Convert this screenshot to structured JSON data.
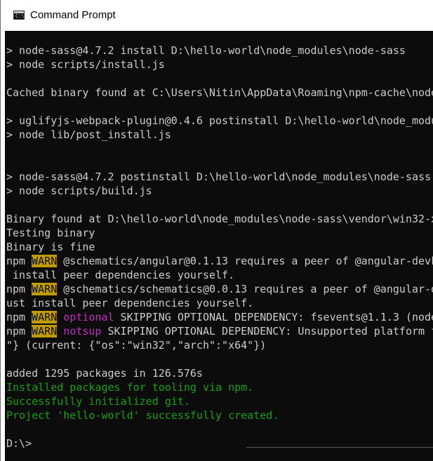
{
  "window": {
    "title": "Command Prompt",
    "icon": "cmd-icon",
    "icon_glyph": "C:\\",
    "colors": {
      "background": "#0c0c0c",
      "text": "#cccccc",
      "warn_background": "#c19c00",
      "warn_text": "#0c0c0c",
      "magenta": "#c12bc1",
      "green": "#13a10e"
    }
  },
  "console": {
    "lines": [
      [
        {
          "t": "> node-sass@4.7.2 install D:\\hello-world\\node_modules\\node-sass"
        }
      ],
      [
        {
          "t": "> node scripts/install.js"
        }
      ],
      [
        {
          "t": ""
        }
      ],
      [
        {
          "t": "Cached binary found at C:\\Users\\Nitin\\AppData\\Roaming\\npm-cache\\node-"
        }
      ],
      [
        {
          "t": ""
        }
      ],
      [
        {
          "t": "> uglifyjs-webpack-plugin@0.4.6 postinstall D:\\hello-world\\node_modu"
        }
      ],
      [
        {
          "t": "> node lib/post_install.js"
        }
      ],
      [
        {
          "t": ""
        }
      ],
      [
        {
          "t": ""
        }
      ],
      [
        {
          "t": "> node-sass@4.7.2 postinstall D:\\hello-world\\node_modules\\node-sass"
        }
      ],
      [
        {
          "t": "> node scripts/build.js"
        }
      ],
      [
        {
          "t": ""
        }
      ],
      [
        {
          "t": "Binary found at D:\\hello-world\\node_modules\\node-sass\\vendor\\win32-x"
        }
      ],
      [
        {
          "t": "Testing binary"
        }
      ],
      [
        {
          "t": "Binary is fine"
        }
      ],
      [
        {
          "t": "npm "
        },
        {
          "t": "WARN",
          "c": "warn"
        },
        {
          "t": " @schematics/angular@0.1.13 requires a peer of @angular-devk"
        }
      ],
      [
        {
          "t": " install peer dependencies yourself."
        }
      ],
      [
        {
          "t": "npm "
        },
        {
          "t": "WARN",
          "c": "warn"
        },
        {
          "t": " @schematics/schematics@0.0.13 requires a peer of @angular-d"
        }
      ],
      [
        {
          "t": "ust install peer dependencies yourself."
        }
      ],
      [
        {
          "t": "npm "
        },
        {
          "t": "WARN",
          "c": "warn"
        },
        {
          "t": " "
        },
        {
          "t": "optional",
          "c": "magenta"
        },
        {
          "t": " SKIPPING OPTIONAL DEPENDENCY: fsevents@1.1.3 (node"
        }
      ],
      [
        {
          "t": "npm "
        },
        {
          "t": "WARN",
          "c": "warn"
        },
        {
          "t": " "
        },
        {
          "t": "notsup",
          "c": "magenta"
        },
        {
          "t": " SKIPPING OPTIONAL DEPENDENCY: Unsupported platform f"
        }
      ],
      [
        {
          "t": "\"} (current: {\"os\":\"win32\",\"arch\":\"x64\"})"
        }
      ],
      [
        {
          "t": ""
        }
      ],
      [
        {
          "t": "added 1295 packages in 126.576s"
        }
      ],
      [
        {
          "t": "Installed packages for tooling via npm.",
          "c": "green"
        }
      ],
      [
        {
          "t": "Successfully initialized git.",
          "c": "green"
        }
      ],
      [
        {
          "t": "Project 'hello-world' successfully created.",
          "c": "green"
        }
      ],
      [
        {
          "t": ""
        }
      ],
      [
        {
          "t": "D:\\>"
        }
      ]
    ]
  }
}
